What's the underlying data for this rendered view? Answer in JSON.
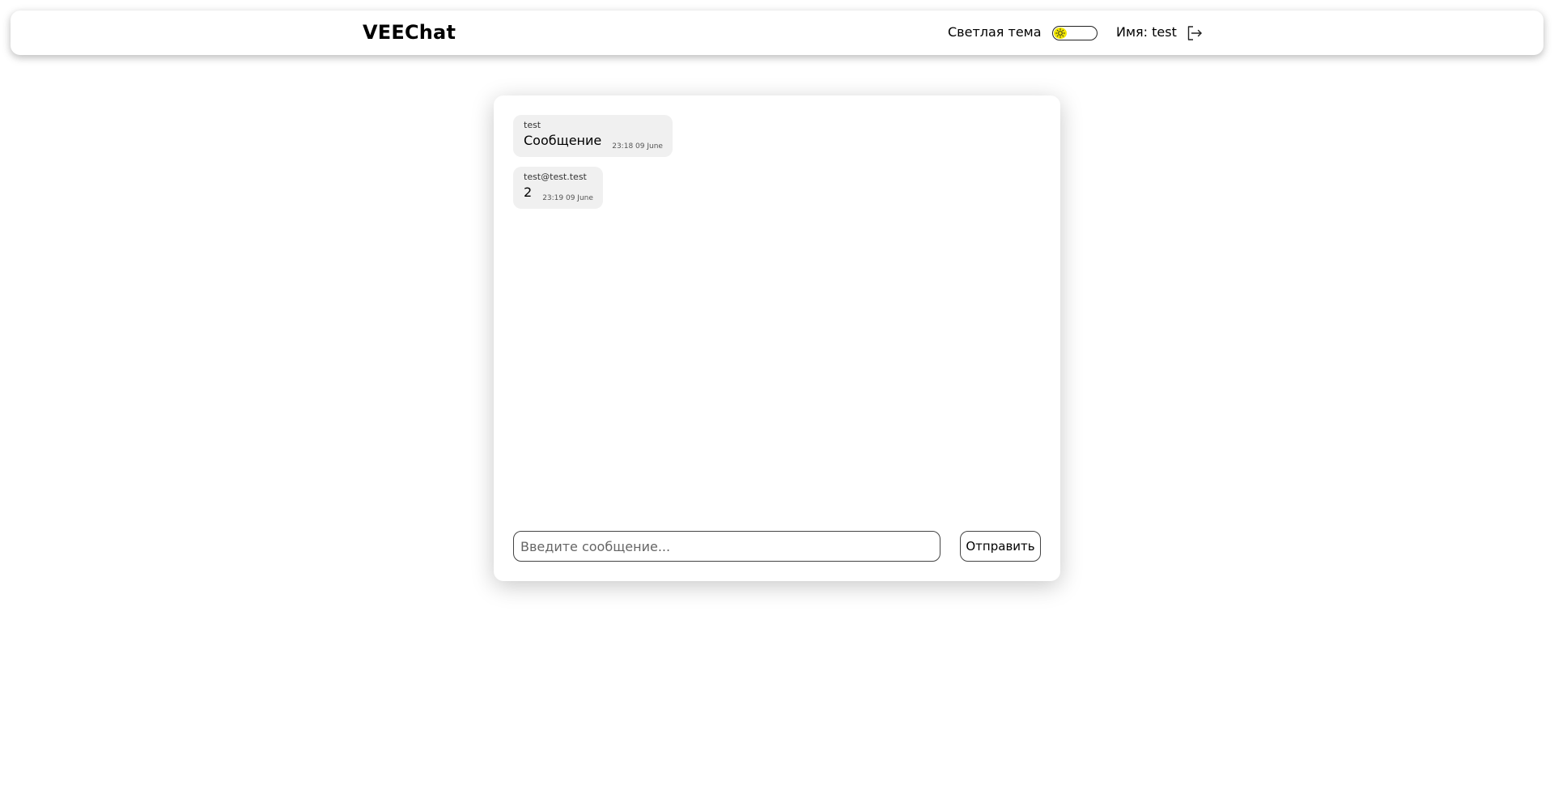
{
  "header": {
    "logo": "VEEChat",
    "theme_label": "Светлая тема",
    "theme_icon": "sun-icon",
    "user_label": "Имя: test",
    "logout_icon": "logout-icon"
  },
  "messages": [
    {
      "author": "test",
      "text": "Сообщение",
      "time": "23:18 09 June"
    },
    {
      "author": "test@test.test",
      "text": "2",
      "time": "23:19 09 June"
    }
  ],
  "composer": {
    "placeholder": "Введите сообщение...",
    "value": "",
    "send_label": "Отправить"
  },
  "colors": {
    "toggle_knob": "#f2e600",
    "message_bg": "#f0f0f0"
  }
}
